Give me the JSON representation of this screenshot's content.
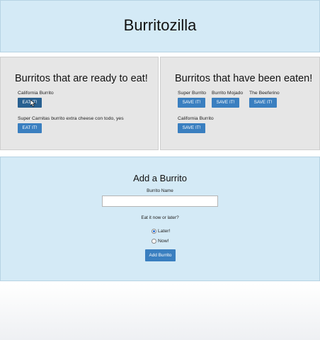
{
  "header": {
    "title": "Burritozilla"
  },
  "ready_panel": {
    "title": "Burritos that are ready to eat!",
    "items": [
      {
        "name": "California Burrito",
        "button": "EAT IT!"
      },
      {
        "name": "Super Carnitas burrito extra cheese con todo, yes",
        "button": "EAT IT!"
      }
    ]
  },
  "eaten_panel": {
    "title": "Burritos that have been eaten!",
    "items": [
      {
        "name": "Super Burrito",
        "button": "SAVE IT!"
      },
      {
        "name": "Burrito Mojado",
        "button": "SAVE IT!"
      },
      {
        "name": "The Beeferino",
        "button": "SAVE IT!"
      },
      {
        "name": "California Burrito",
        "button": "SAVE IT!"
      }
    ]
  },
  "form": {
    "title": "Add a Burrito",
    "name_label": "Burrito Name",
    "name_value": "",
    "question": "Eat it now or later?",
    "options": [
      {
        "label": "Later!",
        "checked": true
      },
      {
        "label": "Now!",
        "checked": false
      }
    ],
    "submit": "Add Burrito"
  },
  "colors": {
    "header_bg": "#d4eaf6",
    "panel_bg": "#e6e6e6",
    "button": "#3a7fc0",
    "button_active": "#286090"
  }
}
